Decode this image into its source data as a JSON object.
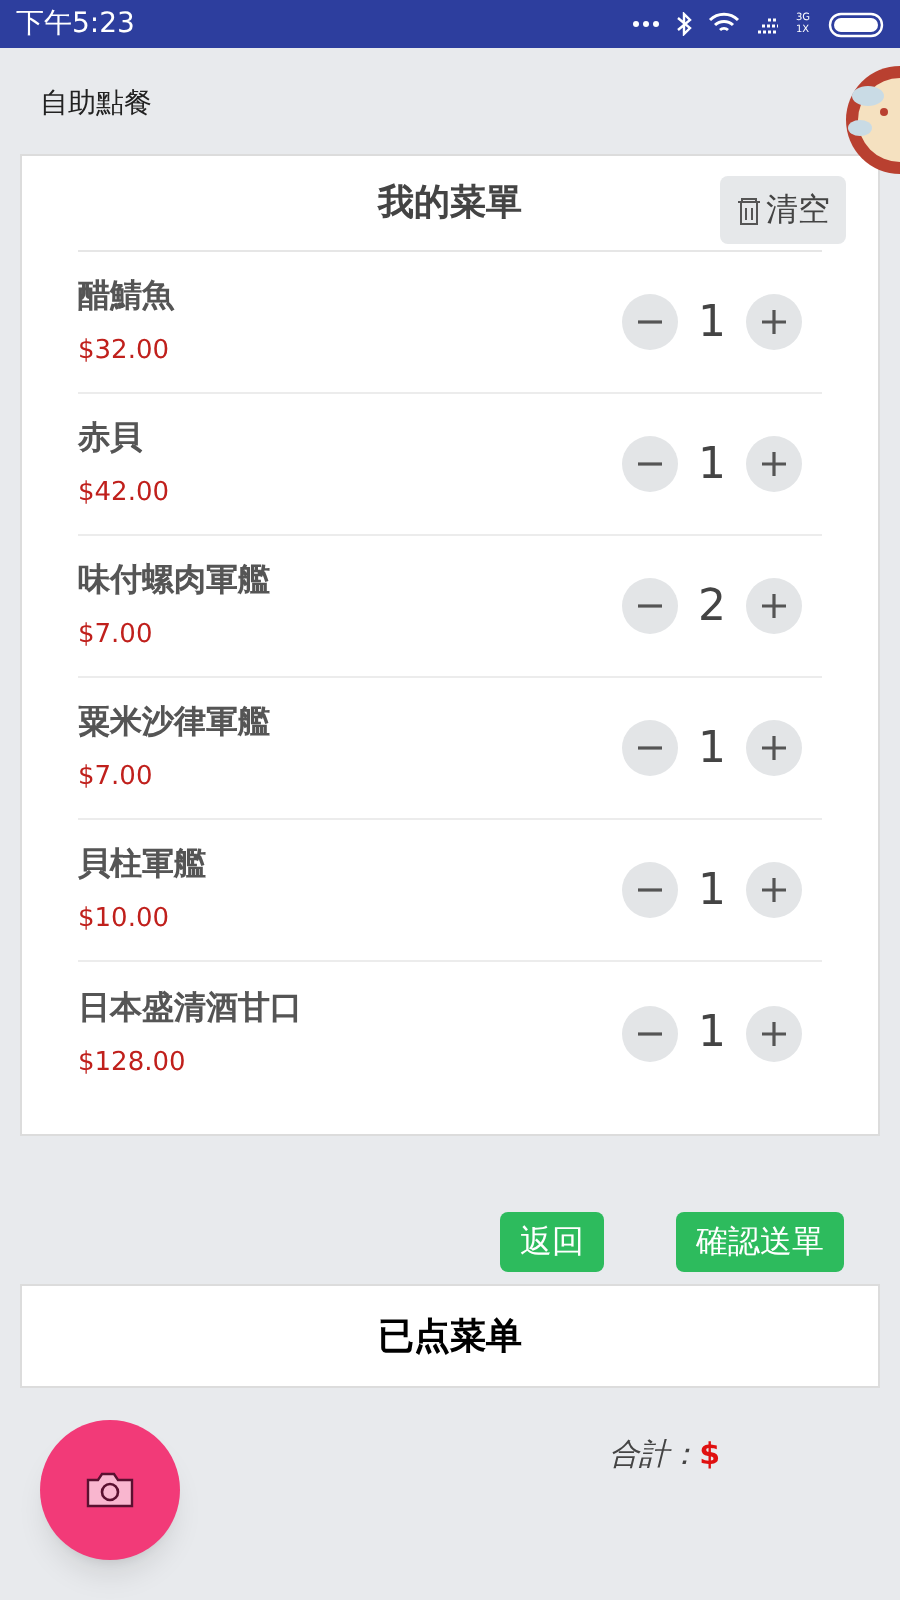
{
  "status_bar": {
    "time": "下午5:23",
    "network": "3G 1X"
  },
  "header": {
    "title": "自助點餐"
  },
  "menu_card": {
    "title": "我的菜單",
    "clear_button": "清空",
    "items": [
      {
        "name": "醋鯖魚",
        "price": "$32.00",
        "quantity": "1"
      },
      {
        "name": "赤貝",
        "price": "$42.00",
        "quantity": "1"
      },
      {
        "name": "味付螺肉軍艦",
        "price": "$7.00",
        "quantity": "2"
      },
      {
        "name": "粟米沙律軍艦",
        "price": "$7.00",
        "quantity": "1"
      },
      {
        "name": "貝柱軍艦",
        "price": "$10.00",
        "quantity": "1"
      },
      {
        "name": "日本盛清酒甘口",
        "price": "$128.00",
        "quantity": "1"
      }
    ]
  },
  "actions": [
    "返回",
    "確認送單"
  ],
  "ordered_panel": {
    "title": "已点菜单"
  },
  "total": {
    "label": "合計：",
    "amount": "$"
  }
}
